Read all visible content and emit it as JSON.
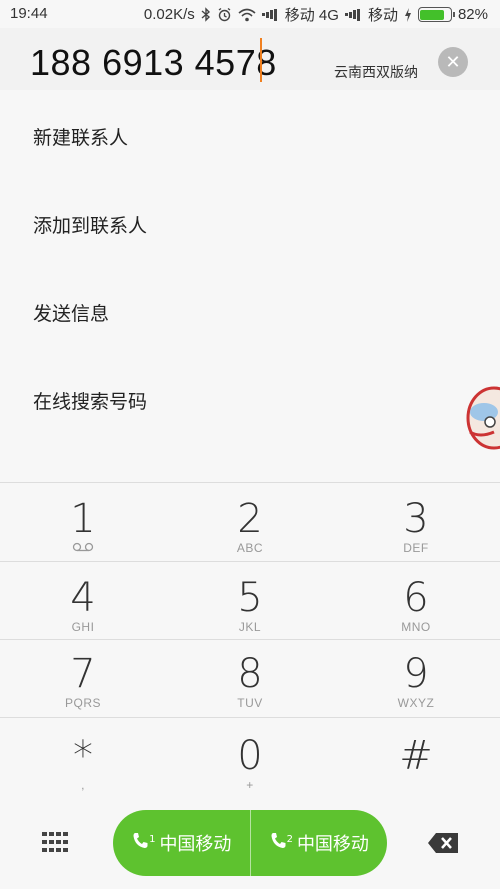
{
  "status_bar": {
    "time": "19:44",
    "speed": "0.02K/s",
    "carrier1": "移动 4G",
    "carrier2": "移动",
    "battery": "82%",
    "battery_level": 0.82
  },
  "number_bar": {
    "number": "188 6913 4578",
    "location": "云南西双版纳"
  },
  "actions": [
    {
      "label": "新建联系人"
    },
    {
      "label": "添加到联系人"
    },
    {
      "label": "发送信息"
    },
    {
      "label": "在线搜索号码"
    }
  ],
  "dialpad": {
    "keys": [
      {
        "digit": "1",
        "letters": ""
      },
      {
        "digit": "2",
        "letters": "ABC"
      },
      {
        "digit": "3",
        "letters": "DEF"
      },
      {
        "digit": "4",
        "letters": "GHI"
      },
      {
        "digit": "5",
        "letters": "JKL"
      },
      {
        "digit": "6",
        "letters": "MNO"
      },
      {
        "digit": "7",
        "letters": "PQRS"
      },
      {
        "digit": "8",
        "letters": "TUV"
      },
      {
        "digit": "9",
        "letters": "WXYZ"
      },
      {
        "digit": "*",
        "letters": ","
      },
      {
        "digit": "0",
        "letters": "+"
      },
      {
        "digit": "#",
        "letters": ""
      }
    ]
  },
  "call": {
    "sim1_label": "中国移动",
    "sim1_index": "1",
    "sim2_label": "中国移动",
    "sim2_index": "2"
  },
  "colors": {
    "call_green": "#5ec22f",
    "caret": "#f08020",
    "battery_green": "#43c02a"
  },
  "icons": {
    "clear": "close-icon",
    "voicemail": "voicemail-icon",
    "dialpad_toggle": "dialpad-icon",
    "backspace": "backspace-icon",
    "call": "phone-icon"
  }
}
